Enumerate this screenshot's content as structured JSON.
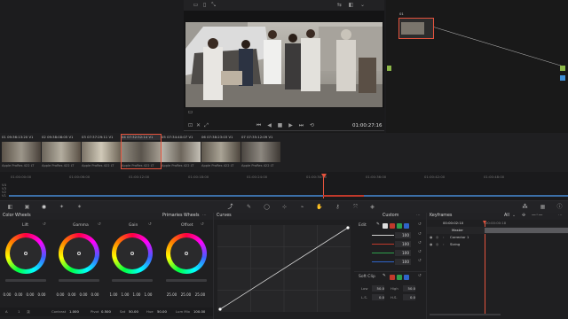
{
  "viewer": {
    "timecode": "01:00:27:16",
    "toolbar_icons": [
      "viewer-layout-icon",
      "split-icon",
      "wipe-icon",
      "highlight-icon",
      "fullscreen-icon"
    ],
    "transport_icons": [
      "skip-back-icon",
      "step-back-icon",
      "stop-icon",
      "play-icon",
      "step-forward-icon",
      "loop-icon"
    ]
  },
  "nodes": {
    "node_label": "01"
  },
  "clips": [
    {
      "num": "01",
      "tc": "09:36:13:20",
      "track": "V1",
      "codec": "Apple ProRes 422 LT",
      "selected": false
    },
    {
      "num": "02",
      "tc": "09:38:08:05",
      "track": "V1",
      "codec": "Apple ProRes 422 LT",
      "selected": false
    },
    {
      "num": "03",
      "tc": "07:37:29:11",
      "track": "V1",
      "codec": "Apple ProRes 422 LT",
      "selected": false
    },
    {
      "num": "04",
      "tc": "07:32:52:14",
      "track": "V1",
      "codec": "Apple ProRes 422 LT",
      "selected": true
    },
    {
      "num": "05",
      "tc": "07:34:40:07",
      "track": "V1",
      "codec": "Apple ProRes 422 LT",
      "selected": false
    },
    {
      "num": "06",
      "tc": "07:38:23:03",
      "track": "V1",
      "codec": "Apple ProRes 422 LT",
      "selected": false
    },
    {
      "num": "07",
      "tc": "07:35:12:09",
      "track": "V1",
      "codec": "Apple ProRes 422 LT",
      "selected": false
    }
  ],
  "timeline": {
    "ruler": [
      "01:00:00:00",
      "01:00:06:00",
      "01:00:12:00",
      "01:00:18:00",
      "01:00:24:00",
      "01:00:30:00",
      "01:00:36:00",
      "01:00:42:00",
      "01:00:48:00"
    ],
    "tracks": [
      "V4",
      "V3",
      "V2",
      "V1"
    ]
  },
  "color_wheels": {
    "title": "Color Wheels",
    "mode": "Primaries Wheels",
    "wheels": [
      {
        "name": "Lift",
        "values": [
          "0.00",
          "0.00",
          "0.00",
          "0.00"
        ]
      },
      {
        "name": "Gamma",
        "values": [
          "0.00",
          "0.00",
          "0.00",
          "0.00"
        ]
      },
      {
        "name": "Gain",
        "values": [
          "1.00",
          "1.00",
          "1.00",
          "1.00"
        ]
      },
      {
        "name": "Offset",
        "values": [
          "25.00",
          "25.00",
          "25.00"
        ]
      }
    ],
    "footer": {
      "page_a": "A",
      "page_1": "1",
      "page_2": "2",
      "contrast_label": "Contrast",
      "contrast": "1.000",
      "pivot_label": "Pivot",
      "pivot": "0.500",
      "sat_label": "Sat",
      "sat": "50.00",
      "hue_label": "Hue",
      "hue": "50.00",
      "lummix_label": "Lum Mix",
      "lummix": "100.00"
    }
  },
  "curves": {
    "title": "Curves",
    "mode": "Custom",
    "edit_label": "Edit",
    "channel_values": [
      "100",
      "100",
      "100",
      "100"
    ],
    "soft_clip_label": "Soft Clip",
    "low_label": "Low",
    "low": "50.0",
    "high_label": "High",
    "high": "50.0",
    "ls_label": "L.S.",
    "ls": "0.0",
    "hs_label": "H.S.",
    "hs": "0.0"
  },
  "keyframes": {
    "title": "Keyframes",
    "filter": "All",
    "timecode": "00:00:02:10",
    "ruler_tc": "00:00:00:18",
    "rows": [
      "Master",
      "Corrector 1",
      "Sizing"
    ]
  },
  "colors": {
    "accent_red": "#c0392b",
    "selected_orange": "#e5533d",
    "node_green": "#8db84a"
  }
}
